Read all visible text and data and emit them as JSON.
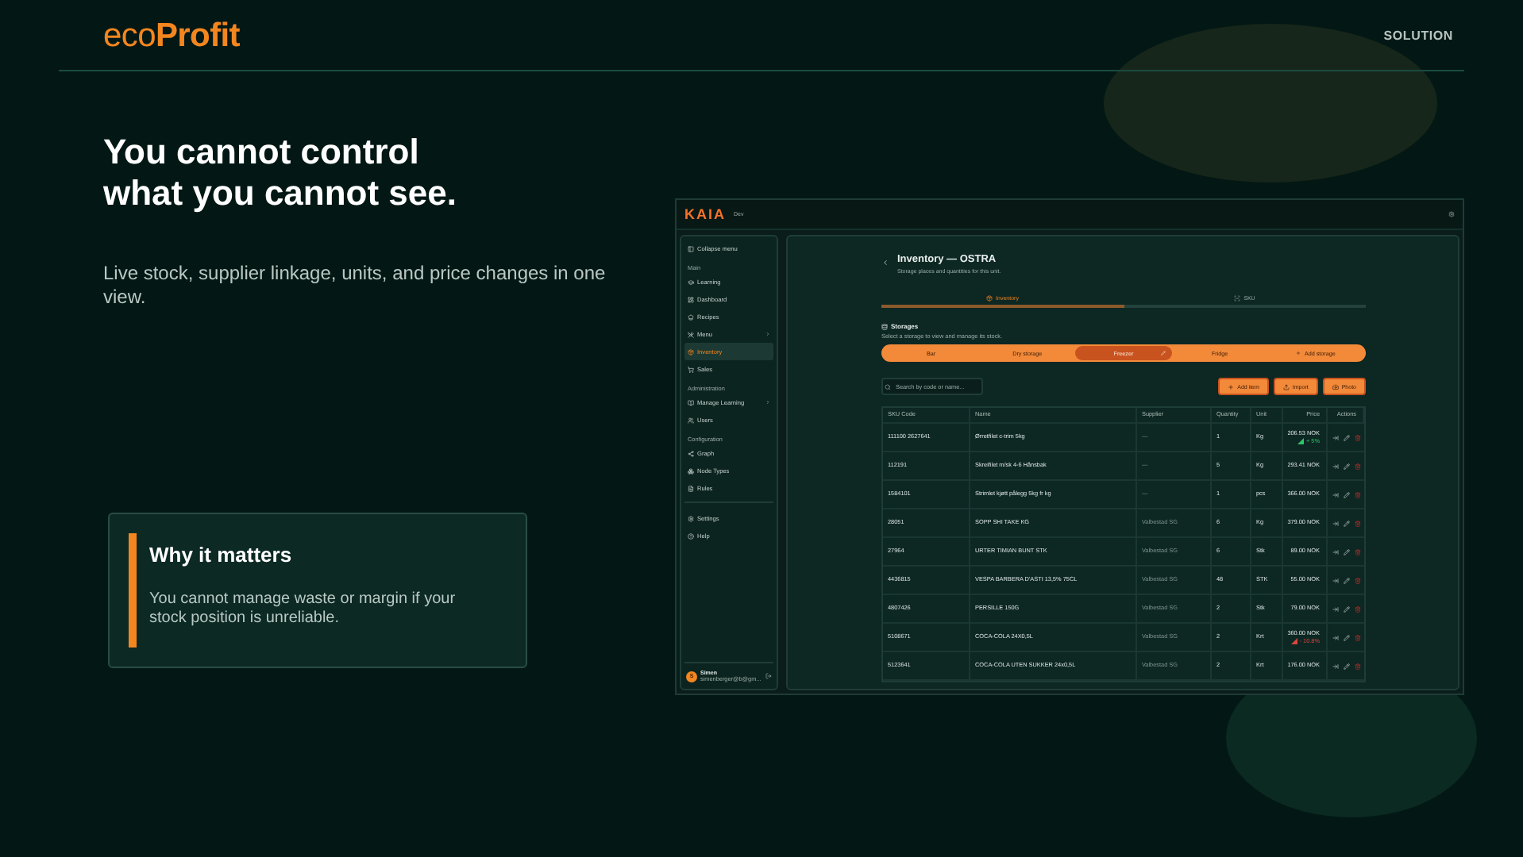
{
  "header": {
    "logo_prefix": "eco",
    "logo_suffix": "Profit",
    "section": "SOLUTION"
  },
  "headline": "You cannot control\nwhat you cannot see.",
  "intro": "Live stock, supplier linkage, units, and price changes in one view.",
  "callout": {
    "title": "Why it matters",
    "body": "You cannot manage waste or margin if your stock position is unreliable."
  },
  "app": {
    "logo": "KAIA",
    "env": "Dev",
    "sidebar": {
      "collapse": "Collapse menu",
      "sections": [
        {
          "title": "Main",
          "items": [
            {
              "label": "Learning",
              "selected": false,
              "expandable": false
            },
            {
              "label": "Dashboard",
              "selected": false,
              "expandable": false
            },
            {
              "label": "Recipes",
              "selected": false,
              "expandable": false
            },
            {
              "label": "Menu",
              "selected": false,
              "expandable": true
            },
            {
              "label": "Inventory",
              "selected": true,
              "expandable": false
            },
            {
              "label": "Sales",
              "selected": false,
              "expandable": false
            }
          ]
        },
        {
          "title": "Administration",
          "items": [
            {
              "label": "Manage Learning",
              "selected": false,
              "expandable": true
            },
            {
              "label": "Users",
              "selected": false,
              "expandable": false
            }
          ]
        },
        {
          "title": "Configuration",
          "items": [
            {
              "label": "Graph",
              "selected": false,
              "expandable": false
            },
            {
              "label": "Node Types",
              "selected": false,
              "expandable": false
            },
            {
              "label": "Rules",
              "selected": false,
              "expandable": false
            }
          ]
        }
      ],
      "footer_items": [
        {
          "label": "Settings",
          "selected": false
        },
        {
          "label": "Help",
          "selected": false
        }
      ],
      "user": {
        "initial": "S",
        "name": "Simen",
        "email": "simenberger@b@gm..."
      }
    },
    "page": {
      "title": "Inventory — OSTRA",
      "subtitle": "Storage places and quantities for this unit.",
      "tabs": [
        {
          "label": "Inventory",
          "selected": true
        },
        {
          "label": "SKU",
          "selected": false
        }
      ],
      "storages": {
        "title": "Storages",
        "subtitle": "Select a storage to view and manage its stock.",
        "items": [
          {
            "label": "Bar",
            "selected": false,
            "kind": "storage"
          },
          {
            "label": "Dry storage",
            "selected": false,
            "kind": "storage"
          },
          {
            "label": "Freezer",
            "selected": true,
            "kind": "storage"
          },
          {
            "label": "Fridge",
            "selected": false,
            "kind": "storage"
          },
          {
            "label": "Add storage",
            "selected": false,
            "kind": "add"
          }
        ]
      },
      "search": {
        "placeholder": "Search by code or name..."
      },
      "buttons": [
        "Add item",
        "Import",
        "Photo"
      ],
      "table": {
        "columns": [
          "SKU Code",
          "Name",
          "Supplier",
          "Quantity",
          "Unit",
          "Price",
          "Actions"
        ],
        "rows": [
          {
            "sku": "111100 2627641",
            "name": "Ørretfilet c-trim 5kg",
            "supplier": "—",
            "quantity": "1",
            "unit": "Kg",
            "price": "206.53 NOK",
            "change": "+ 5%",
            "color": "#2fc46b"
          },
          {
            "sku": "112191",
            "name": "Skreifilet m/sk 4-6 Hånsbak",
            "supplier": "—",
            "quantity": "5",
            "unit": "Kg",
            "price": "293.41 NOK"
          },
          {
            "sku": "1584101",
            "name": "Strimlet kjøtt pålegg 5kg fr kg",
            "supplier": "—",
            "quantity": "1",
            "unit": "pcs",
            "price": "366.00 NOK"
          },
          {
            "sku": "28051",
            "name": "SOPP SHI TAKE KG",
            "supplier": "Valbestad SG",
            "quantity": "6",
            "unit": "Kg",
            "price": "379.00 NOK"
          },
          {
            "sku": "27964",
            "name": "URTER TIMIAN BUNT STK",
            "supplier": "Valbestad SG",
            "quantity": "6",
            "unit": "Stk",
            "price": "89.00 NOK"
          },
          {
            "sku": "4436815",
            "name": "VESPA BARBERA D'ASTI 13,5% 75CL",
            "supplier": "Valbestad SG",
            "quantity": "48",
            "unit": "STK",
            "price": "55.00 NOK"
          },
          {
            "sku": "4807426",
            "name": "PERSILLE 150G",
            "supplier": "Valbestad SG",
            "quantity": "2",
            "unit": "Stk",
            "price": "79.00 NOK"
          },
          {
            "sku": "5108671",
            "name": "COCA-COLA 24X0,5L",
            "supplier": "Valbestad SG",
            "quantity": "2",
            "unit": "Krt",
            "price": "360.00 NOK",
            "change": "- 10.8%",
            "color": "#d9463e"
          },
          {
            "sku": "5123641",
            "name": "COCA-COLA UTEN SUKKER 24x0,5L",
            "supplier": "Valbestad SG",
            "quantity": "2",
            "unit": "Krt",
            "price": "176.00 NOK"
          }
        ]
      }
    }
  }
}
